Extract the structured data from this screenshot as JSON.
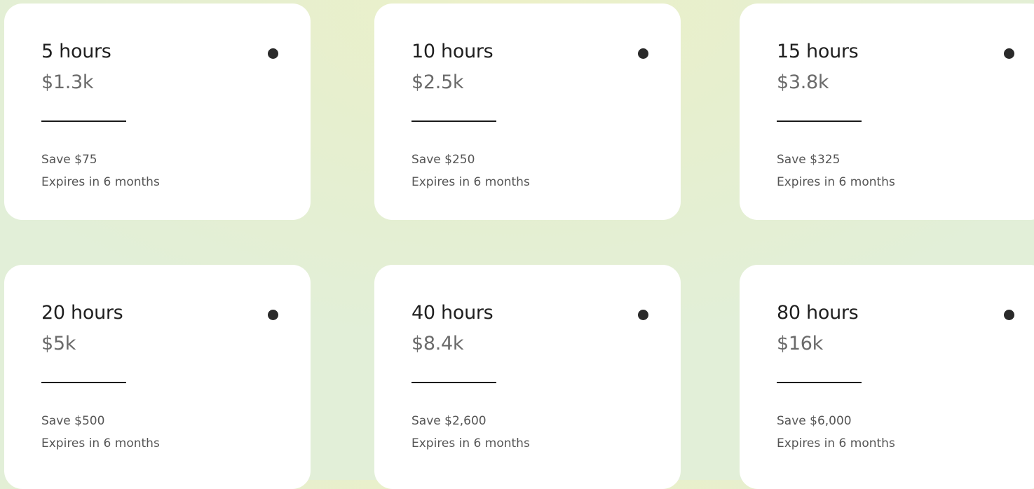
{
  "packages": [
    {
      "hours": "5 hours",
      "price": "$1.3k",
      "save": "Save $75",
      "expires": "Expires in 6 months"
    },
    {
      "hours": "10 hours",
      "price": "$2.5k",
      "save": "Save $250",
      "expires": "Expires in 6 months"
    },
    {
      "hours": "15 hours",
      "price": "$3.8k",
      "save": "Save $325",
      "expires": "Expires in 6 months"
    },
    {
      "hours": "20 hours",
      "price": "$5k",
      "save": "Save $500",
      "expires": "Expires in 6 months"
    },
    {
      "hours": "40 hours",
      "price": "$8.4k",
      "save": "Save $2,600",
      "expires": "Expires in 6 months"
    },
    {
      "hours": "80 hours",
      "price": "$16k",
      "save": "Save $6,000",
      "expires": "Expires in 6 months"
    }
  ],
  "icons": {
    "selector": "radio-dot-icon"
  },
  "colors": {
    "card_background": "#ffffff",
    "primary_text": "#1f1f1f",
    "price_text": "#6b6b6b",
    "secondary_text": "#555555",
    "accent_dot": "#2a2a2a",
    "background_tint": "#e6efcf"
  }
}
